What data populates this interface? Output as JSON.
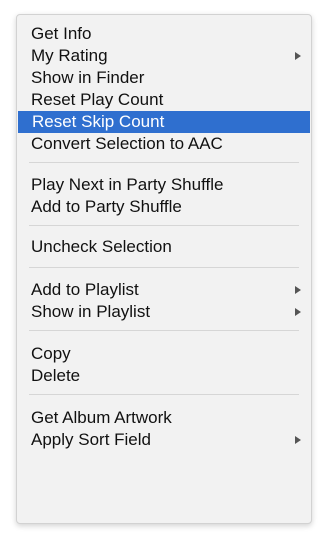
{
  "context_menu": {
    "items": [
      {
        "label": "Get Info"
      },
      {
        "label": "My Rating"
      },
      {
        "label": "Show in Finder"
      },
      {
        "label": "Reset Play Count"
      },
      {
        "label": "Reset Skip Count"
      },
      {
        "label": "Convert Selection to AAC"
      },
      {
        "label": "Play Next in Party Shuffle"
      },
      {
        "label": "Add to Party Shuffle"
      },
      {
        "label": "Uncheck Selection"
      },
      {
        "label": "Add to Playlist"
      },
      {
        "label": "Show in Playlist"
      },
      {
        "label": "Copy"
      },
      {
        "label": "Delete"
      },
      {
        "label": "Get Album Artwork"
      },
      {
        "label": "Apply Sort Field"
      }
    ],
    "highlighted_item": "Reset Skip Count",
    "submenu_items": [
      "My Rating",
      "Add to Playlist",
      "Show in Playlist",
      "Apply Sort Field"
    ],
    "colors": {
      "highlight": "#2f6fcf",
      "menu_background": "#f2f2f2",
      "text": "#111111"
    },
    "icons": {
      "submenu": "chevron-right-icon"
    }
  }
}
